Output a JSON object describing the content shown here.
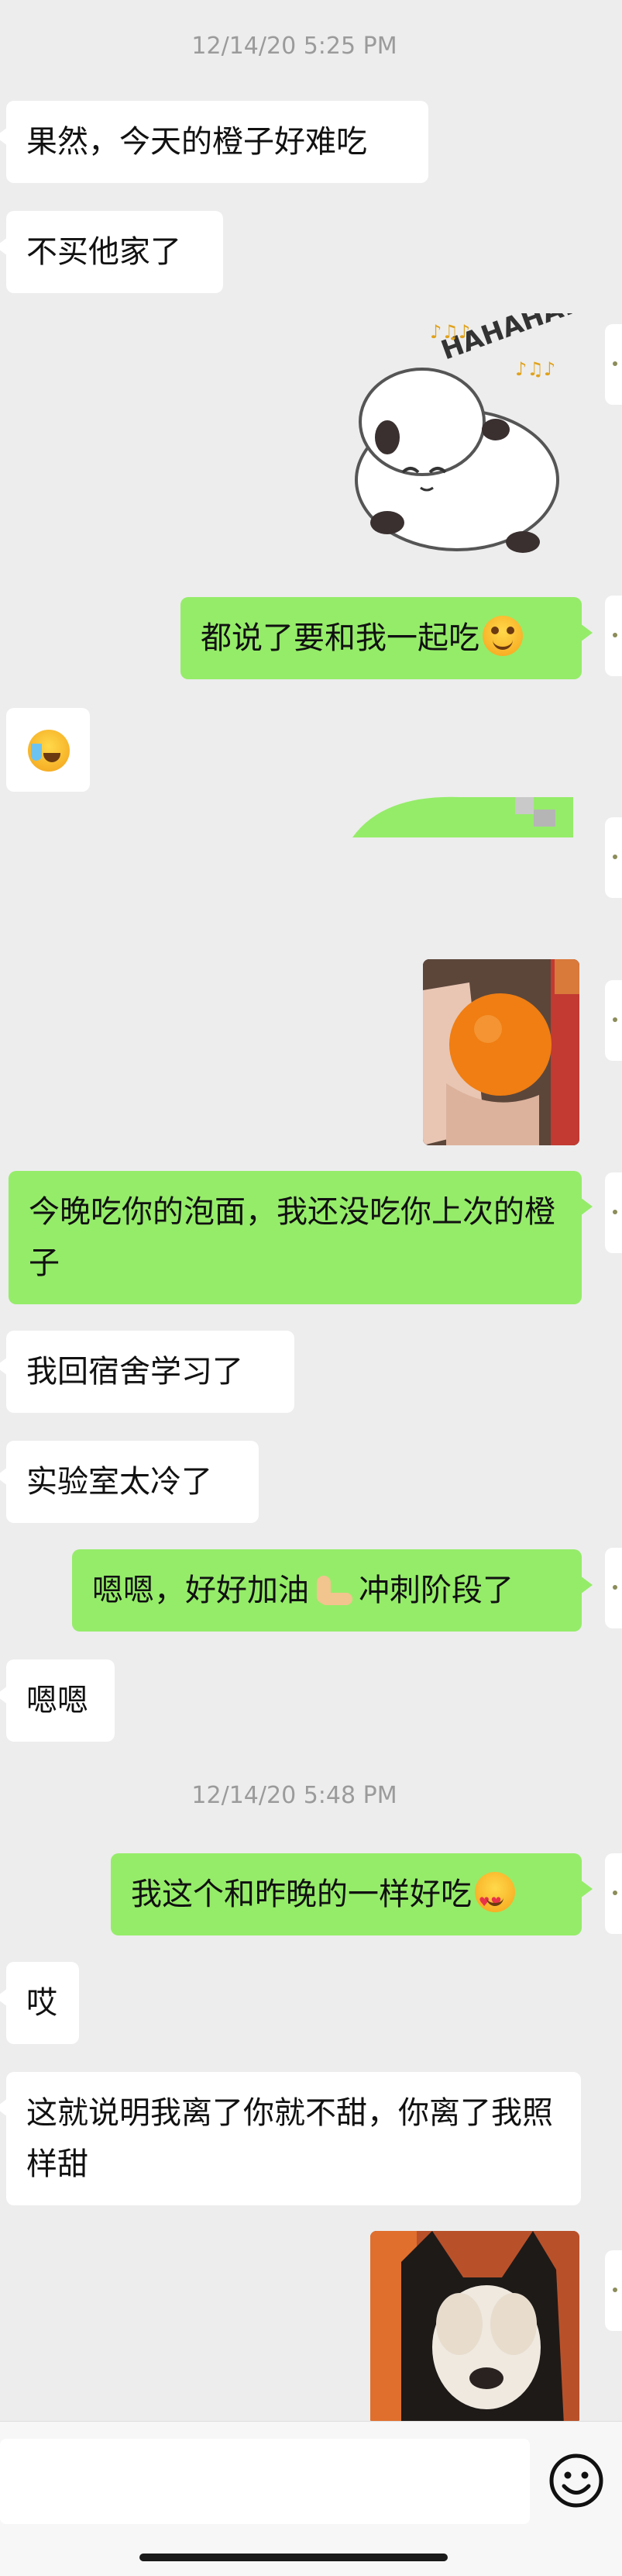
{
  "timestamps": [
    "12/14/20 5:25 PM",
    "12/14/20 5:48 PM"
  ],
  "messages": {
    "m1": "果然，今天的橙子好难吃",
    "m2": "不买他家了",
    "m3": "都说了要和我一起吃",
    "m5": "今晚吃你的泡面，我还没吃你上次的橙子",
    "m6": "我回宿舍学习了",
    "m7": "实验室太冷了",
    "m8a": "嗯嗯，好好加油",
    "m8b": "冲刺阶段了",
    "m9": "嗯嗯",
    "m10": "我这个和昨晚的一样好吃",
    "m11": "哎",
    "m12": "这就说明我离了你就不甜，你离了我照样甜"
  },
  "sticker": {
    "text": "HAHAHA..."
  },
  "input": {
    "value": ""
  },
  "colors": {
    "background": "#ededed",
    "outgoing_bubble": "#95ec69",
    "incoming_bubble": "#ffffff",
    "timestamp": "#9b9b9b"
  },
  "icons": {
    "emoji_button": "smiley-face-icon",
    "cry_emoji": "crying-face-emoji",
    "smile_emoji": "smiling-face-emoji",
    "heart_eyes_emoji": "heart-eyes-emoji",
    "muscle_emoji": "flexed-biceps-emoji"
  }
}
